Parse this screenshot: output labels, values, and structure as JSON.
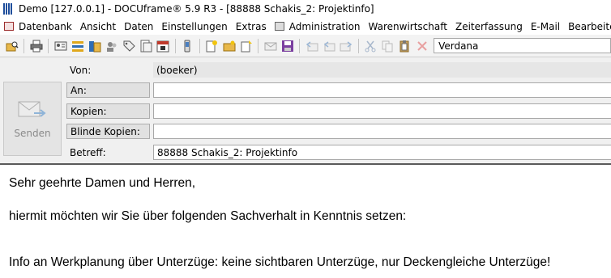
{
  "window": {
    "title": "Demo [127.0.0.1] - DOCUframe® 5.9 R3 - [88888 Schakis_2: Projektinfo]"
  },
  "menu": [
    {
      "label": "Datenbank",
      "icon": "database-icon"
    },
    {
      "label": "Ansicht",
      "icon": ""
    },
    {
      "label": "Daten",
      "icon": ""
    },
    {
      "label": "Einstellungen",
      "icon": ""
    },
    {
      "label": "Extras",
      "icon": ""
    },
    {
      "label": "Administration",
      "icon": "admin-icon"
    },
    {
      "label": "Warenwirtschaft",
      "icon": ""
    },
    {
      "label": "Zeiterfassung",
      "icon": ""
    },
    {
      "label": "E-Mail",
      "icon": ""
    },
    {
      "label": "Bearbeiten",
      "icon": ""
    }
  ],
  "toolbar": {
    "font": "Verdana"
  },
  "send": {
    "label": "Senden"
  },
  "fields": {
    "from_label": "Von:",
    "from_value": "(boeker)",
    "to_label": "An:",
    "to_value": "",
    "cc_label": "Kopien:",
    "cc_value": "",
    "bcc_label": "Blinde Kopien:",
    "bcc_value": "",
    "subject_label": "Betreff:",
    "subject_value": "88888 Schakis_2: Projektinfo"
  },
  "body": {
    "line1": "Sehr geehrte Damen und Herren,",
    "line2": "hiermit möchten wir Sie über folgenden Sachverhalt in Kenntnis setzen:",
    "line3": "Info an Werkplanung über Unterzüge: keine sichtbaren Unterzüge, nur Deckengleiche Unterzüge!"
  }
}
